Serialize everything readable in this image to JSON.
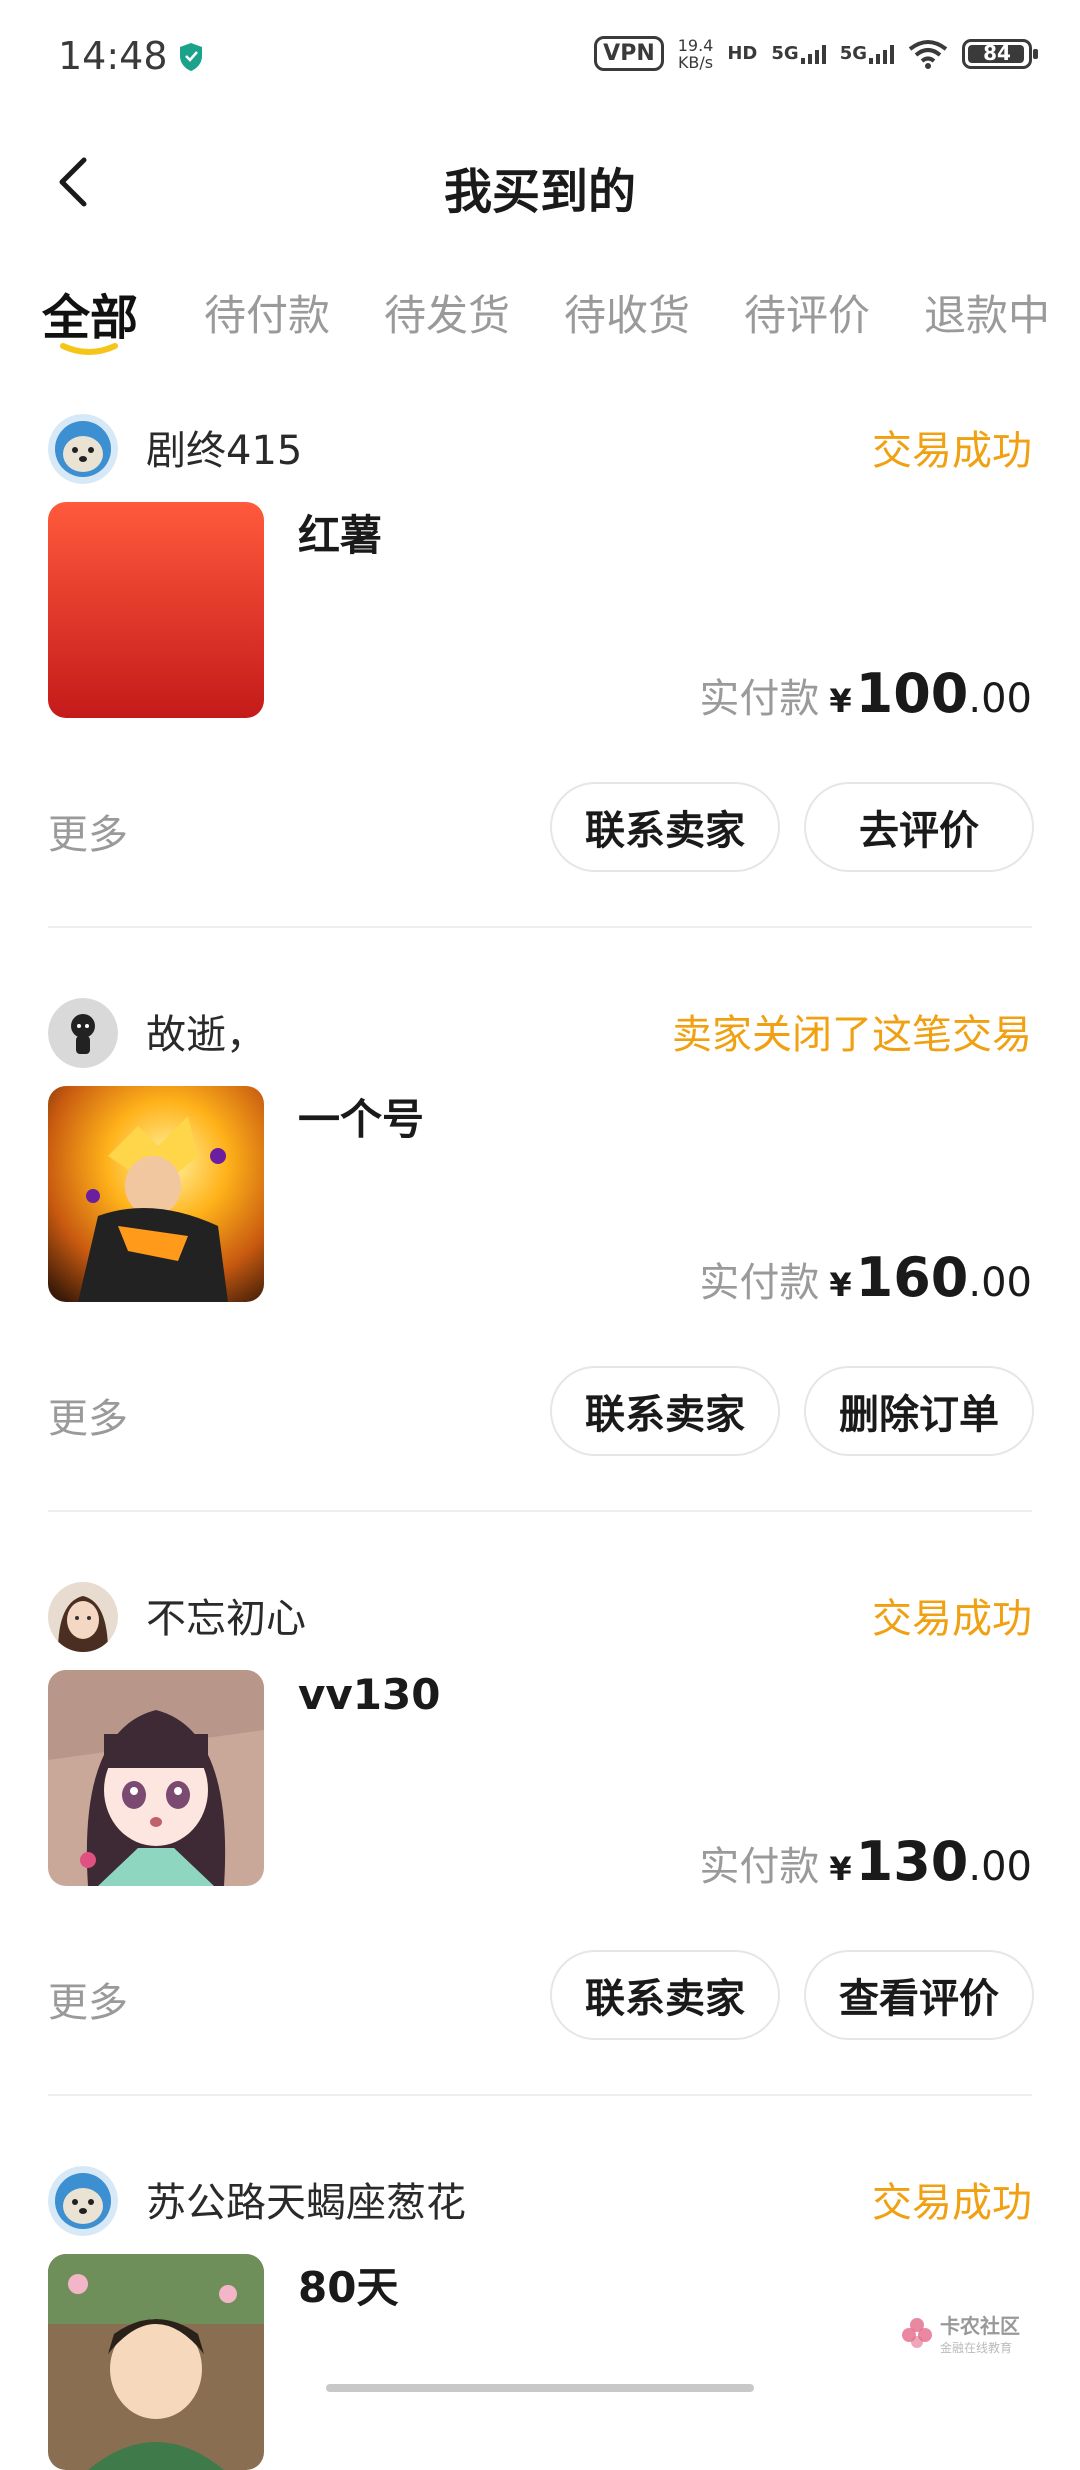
{
  "status_bar": {
    "time": "14:48",
    "vpn": "VPN",
    "speed_value": "19.4",
    "speed_unit": "KB/s",
    "hd": "HD",
    "signal1": "5G",
    "signal2": "5G",
    "battery": "84"
  },
  "header": {
    "title": "我买到的",
    "back_icon": "chevron-left-icon"
  },
  "tabs": [
    {
      "label": "全部",
      "active": true
    },
    {
      "label": "待付款"
    },
    {
      "label": "待发货"
    },
    {
      "label": "待收货"
    },
    {
      "label": "待评价"
    },
    {
      "label": "退款中"
    }
  ],
  "colors": {
    "accent": "#f0a010",
    "tab_underline": "#f5c518"
  },
  "orders": [
    {
      "seller": "剧终415",
      "status": "交易成功",
      "product": "红薯",
      "paid_label": "实付款",
      "currency": "¥",
      "amount_int": "100",
      "amount_dec": ".00",
      "more": "更多",
      "buttons": [
        "联系卖家",
        "去评价"
      ]
    },
    {
      "seller": "故逝，",
      "status": "卖家关闭了这笔交易",
      "product": "一个号",
      "paid_label": "实付款",
      "currency": "¥",
      "amount_int": "160",
      "amount_dec": ".00",
      "more": "更多",
      "buttons": [
        "联系卖家",
        "删除订单"
      ]
    },
    {
      "seller": "不忘初心",
      "status": "交易成功",
      "product": "vv130",
      "paid_label": "实付款",
      "currency": "¥",
      "amount_int": "130",
      "amount_dec": ".00",
      "more": "更多",
      "buttons": [
        "联系卖家",
        "查看评价"
      ]
    },
    {
      "seller": "苏公路天蝎座葱花",
      "status": "交易成功",
      "product": "80天"
    }
  ],
  "watermark": {
    "main": "卡农社区",
    "sub": "金融在线教育"
  }
}
